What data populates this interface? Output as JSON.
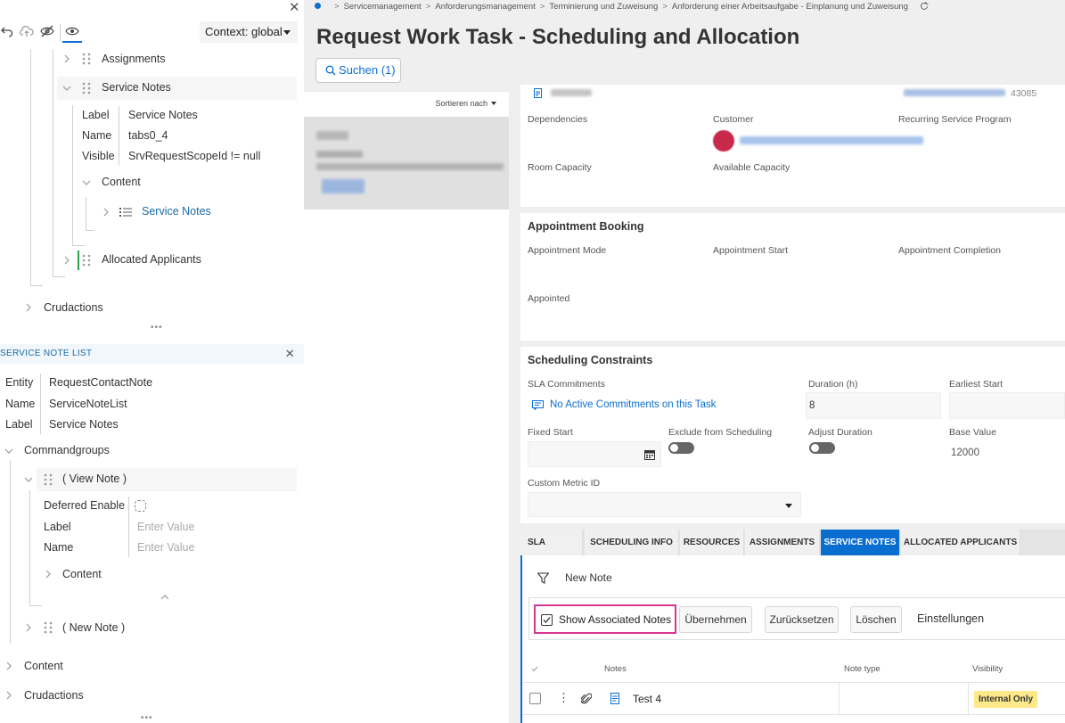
{
  "left_panel": {
    "context_select": {
      "value": "Context: global"
    },
    "tree": {
      "assignments": "Assignments",
      "service_notes": "Service Notes",
      "props": [
        {
          "key": "Label",
          "value": "Service Notes"
        },
        {
          "key": "Name",
          "value": "tabs0_4"
        },
        {
          "key": "Visible",
          "value": "SrvRequestScopeId != null"
        }
      ],
      "content": "Content",
      "service_notes_child": "Service Notes",
      "allocated_applicants": "Allocated Applicants",
      "crudactions": "Crudactions"
    },
    "service_note_list": {
      "header": "SERVICE NOTE LIST",
      "props": [
        {
          "key": "Entity",
          "value": "RequestContactNote"
        },
        {
          "key": "Name",
          "value": "ServiceNoteList"
        },
        {
          "key": "Label",
          "value": "Service Notes"
        }
      ],
      "commandgroups": "Commandgroups",
      "view_note": "( View Note )",
      "deferred_enable": "Deferred Enable",
      "label_key": "Label",
      "label_placeholder": "Enter Value",
      "name_key": "Name",
      "name_placeholder": "Enter Value",
      "content": "Content",
      "new_note_group": "( New Note )",
      "content_bottom": "Content",
      "crudactions_bottom": "Crudactions"
    }
  },
  "main": {
    "breadcrumb": [
      "Servicemanagement",
      "Anforderungsmanagement",
      "Terminierung und Zuweisung",
      "Anforderung einer Arbeitsaufgabe - Einplanung und Zuweisung"
    ],
    "title": "Request Work Task - Scheduling and Allocation",
    "search_button": "Suchen (1)",
    "sort_label": "Sortieren nach",
    "record_number": "43085",
    "details": {
      "dependencies": "Dependencies",
      "customer": "Customer",
      "recurring_service_program": "Recurring Service Program",
      "room_capacity": "Room Capacity",
      "available_capacity": "Available Capacity"
    },
    "appointment_booking": {
      "title": "Appointment Booking",
      "mode": "Appointment Mode",
      "start": "Appointment Start",
      "completion": "Appointment Completion",
      "appointed": "Appointed"
    },
    "scheduling_constraints": {
      "title": "Scheduling Constraints",
      "sla_commitments": "SLA Commitments",
      "sla_link": "No Active Commitments on this Task",
      "duration_label": "Duration (h)",
      "duration_value": "8",
      "earliest_start": "Earliest Start",
      "fixed_start": "Fixed Start",
      "exclude_from_scheduling": "Exclude from Scheduling",
      "adjust_duration": "Adjust Duration",
      "base_value_label": "Base Value",
      "base_value": "12000",
      "custom_metric_id": "Custom Metric ID"
    },
    "tabs": [
      "SLA",
      "SCHEDULING INFO",
      "RESOURCES",
      "ASSIGNMENTS",
      "SERVICE NOTES",
      "ALLOCATED APPLICANTS"
    ],
    "active_tab": "SERVICE NOTES",
    "notes": {
      "new_note": "New Note",
      "show_associated": "Show Associated Notes",
      "apply": "Übernehmen",
      "reset": "Zurücksetzen",
      "delete": "Löschen",
      "settings": "Einstellungen",
      "columns": [
        "Notes",
        "Note type",
        "Visibility"
      ],
      "rows": [
        {
          "note": "Test 4",
          "type": "",
          "visibility": "Internal Only"
        }
      ]
    }
  },
  "colors": {
    "accent": "#0a6ed1",
    "highlight_border": "#d6378e",
    "badge": "#fde98a"
  }
}
